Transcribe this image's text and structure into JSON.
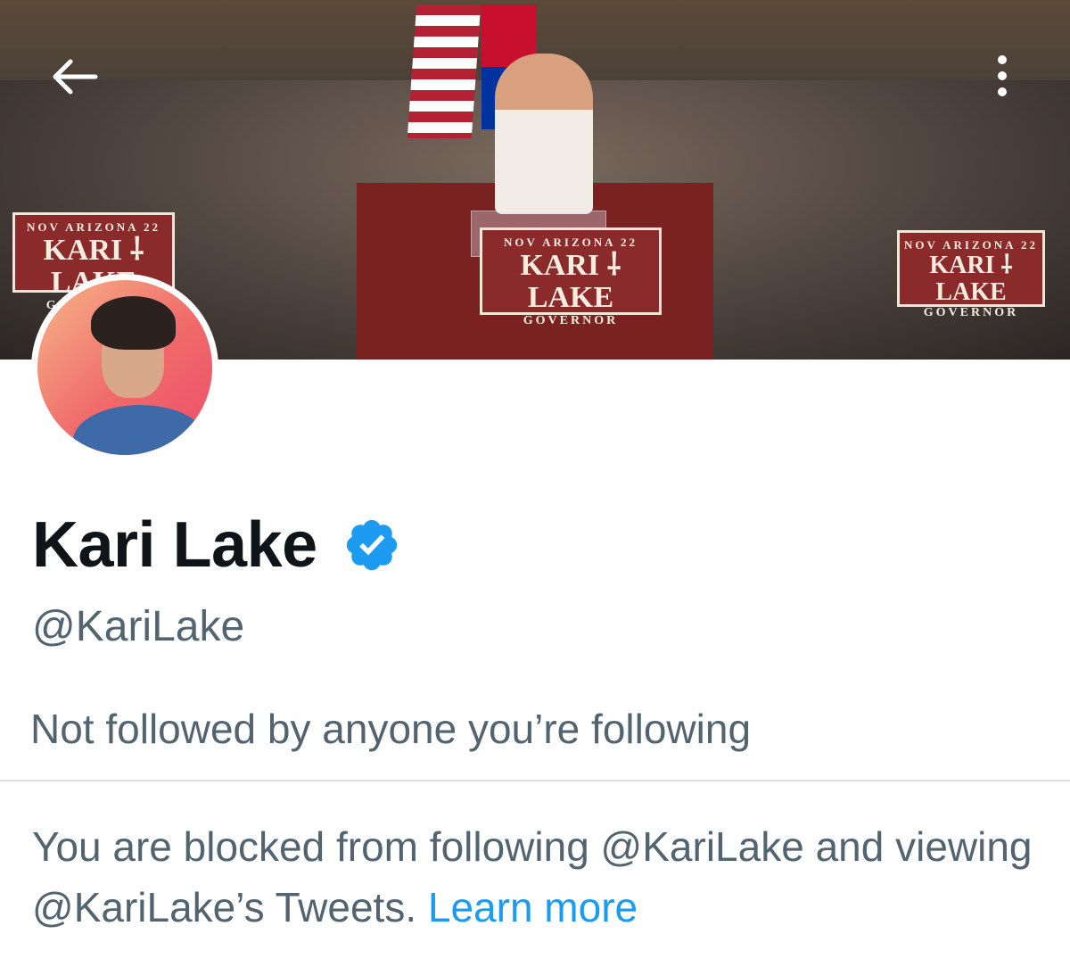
{
  "profile": {
    "name": "Kari Lake",
    "handle": "@KariLake",
    "followers_note": "Not followed by anyone you’re following",
    "blocked_message": "You are blocked from following @KariLake and viewing @KariLake’s Tweets.",
    "learn_more": "Learn more",
    "verified": true
  },
  "banner": {
    "signs": [
      {
        "top": "NOV   ARIZONA   22",
        "main": "KARI ⸸ LAKE",
        "bottom": "GOVERNOR"
      },
      {
        "top": "NOV   ARIZONA   22",
        "main": "KARI ⸸ LAKE",
        "bottom": "GOVERNOR"
      },
      {
        "top": "NOV   ARIZONA   22",
        "main": "KARI ⸸ LAKE",
        "bottom": "GOVERNOR"
      }
    ]
  },
  "icons": {
    "back": "arrow-left-icon",
    "more": "more-vertical-icon",
    "verified": "verified-badge-icon"
  },
  "colors": {
    "accent": "#1d9bf0",
    "text_primary": "#0f1419",
    "text_secondary": "#536471",
    "divider": "#dcdfe2"
  }
}
